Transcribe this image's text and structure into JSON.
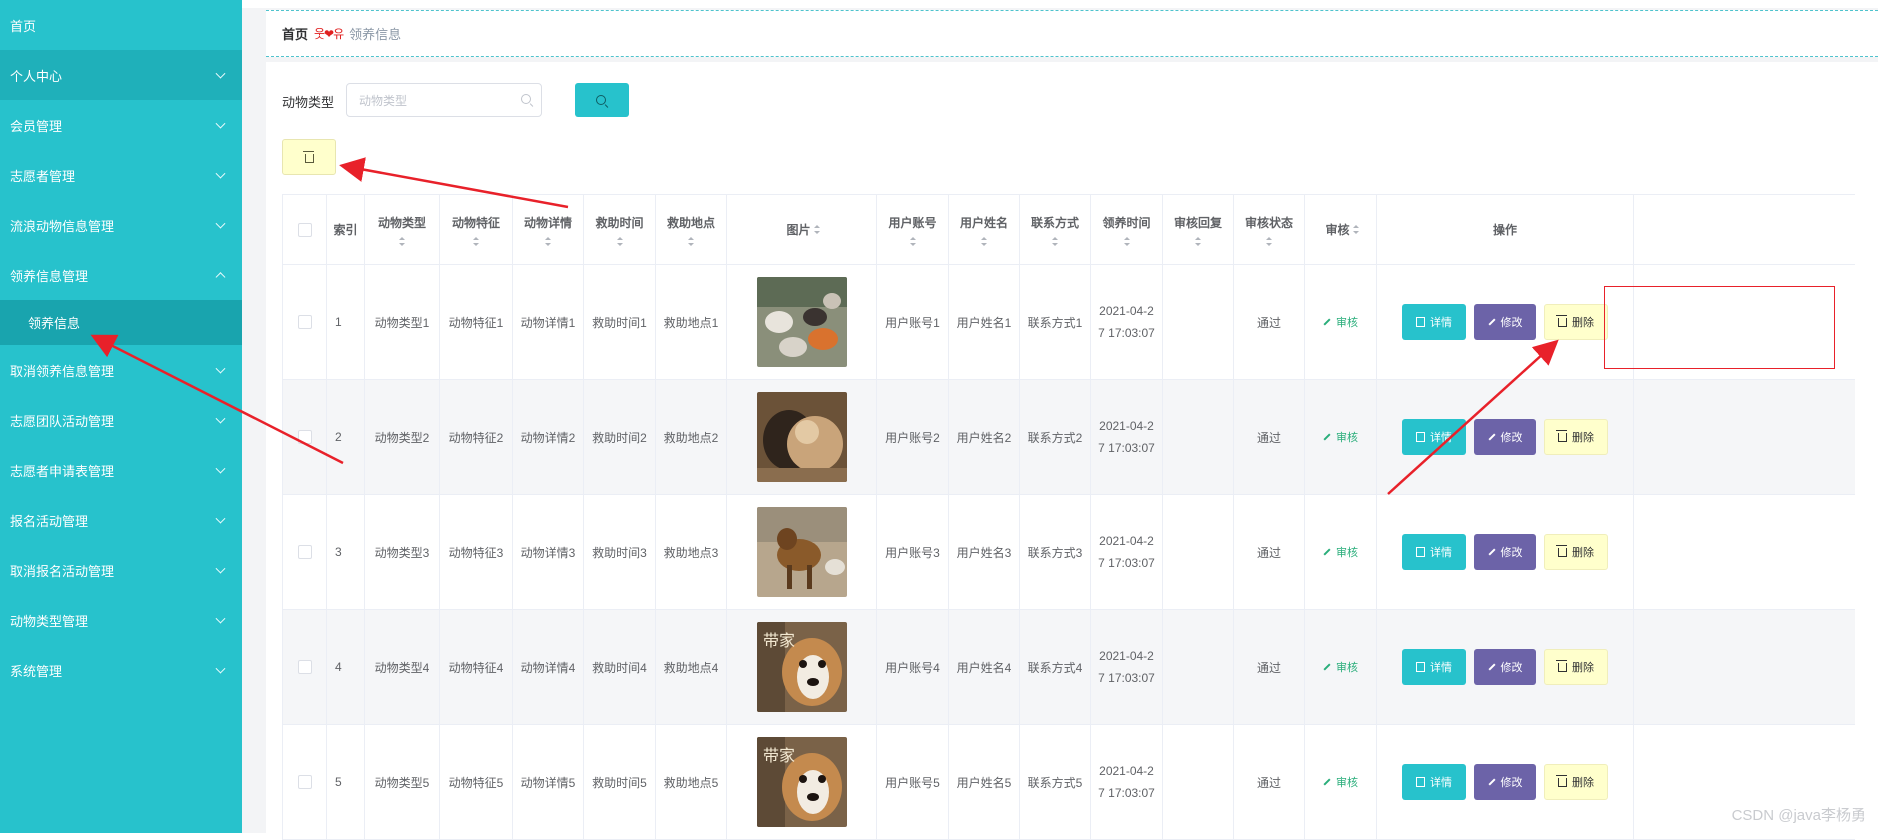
{
  "sidebar": {
    "items": [
      {
        "label": "首页",
        "has_arrow": false
      },
      {
        "label": "个人中心",
        "has_arrow": true
      },
      {
        "label": "会员管理",
        "has_arrow": true
      },
      {
        "label": "志愿者管理",
        "has_arrow": true
      },
      {
        "label": "流浪动物信息管理",
        "has_arrow": true
      },
      {
        "label": "领养信息管理",
        "has_arrow": true,
        "expanded": true
      },
      {
        "label": "领养信息",
        "submenu": true
      },
      {
        "label": "取消领养信息管理",
        "has_arrow": true
      },
      {
        "label": "志愿团队活动管理",
        "has_arrow": true
      },
      {
        "label": "志愿者申请表管理",
        "has_arrow": true
      },
      {
        "label": "报名活动管理",
        "has_arrow": true
      },
      {
        "label": "取消报名活动管理",
        "has_arrow": true
      },
      {
        "label": "动物类型管理",
        "has_arrow": true
      },
      {
        "label": "系统管理",
        "has_arrow": true
      }
    ]
  },
  "breadcrumb": {
    "home": "首页",
    "separator": "웃❤유",
    "current": "领养信息"
  },
  "search": {
    "label": "动物类型",
    "placeholder": "动物类型"
  },
  "table": {
    "headers": [
      "索引",
      "动物类型",
      "动物特征",
      "动物详情",
      "救助时间",
      "救助地点",
      "图片",
      "用户账号",
      "用户姓名",
      "联系方式",
      "领养时间",
      "审核回复",
      "审核状态",
      "审核",
      "操作"
    ],
    "rows": [
      {
        "index": "1",
        "type": "动物类型1",
        "feature": "动物特征1",
        "detail": "动物详情1",
        "rescue_time": "救助时间1",
        "rescue_place": "救助地点1",
        "image": "cats photo",
        "account": "用户账号1",
        "name": "用户姓名1",
        "contact": "联系方式1",
        "date_line1": "2021-04-2",
        "date_line2": "7 17:03:07",
        "reply": "",
        "status": "通过",
        "audit": "审核"
      },
      {
        "index": "2",
        "type": "动物类型2",
        "feature": "动物特征2",
        "detail": "动物详情2",
        "rescue_time": "救助时间2",
        "rescue_place": "救助地点2",
        "image": "dogs cuddling photo",
        "account": "用户账号2",
        "name": "用户姓名2",
        "contact": "联系方式2",
        "date_line1": "2021-04-2",
        "date_line2": "7 17:03:07",
        "reply": "",
        "status": "通过",
        "audit": "审核"
      },
      {
        "index": "3",
        "type": "动物类型3",
        "feature": "动物特征3",
        "detail": "动物详情3",
        "rescue_time": "救助时间3",
        "rescue_place": "救助地点3",
        "image": "stray dog photo",
        "account": "用户账号3",
        "name": "用户姓名3",
        "contact": "联系方式3",
        "date_line1": "2021-04-2",
        "date_line2": "7 17:03:07",
        "reply": "",
        "status": "通过",
        "audit": "审核"
      },
      {
        "index": "4",
        "type": "动物类型4",
        "feature": "动物特征4",
        "detail": "动物详情4",
        "rescue_time": "救助时间4",
        "rescue_place": "救助地点4",
        "image": "puppy poster",
        "image_text": "带家",
        "account": "用户账号4",
        "name": "用户姓名4",
        "contact": "联系方式4",
        "date_line1": "2021-04-2",
        "date_line2": "7 17:03:07",
        "reply": "",
        "status": "通过",
        "audit": "审核"
      },
      {
        "index": "5",
        "type": "动物类型5",
        "feature": "动物特征5",
        "detail": "动物详情5",
        "rescue_time": "救助时间5",
        "rescue_place": "救助地点5",
        "image": "puppy poster",
        "image_text": "带家",
        "account": "用户账号5",
        "name": "用户姓名5",
        "contact": "联系方式5",
        "date_line1": "2021-04-2",
        "date_line2": "7 17:03:07",
        "reply": "",
        "status": "通过",
        "audit": "审核"
      }
    ],
    "actions": {
      "detail": "详情",
      "edit": "修改",
      "delete": "删除"
    }
  },
  "watermark": "CSDN @java李杨勇",
  "colors": {
    "sidebar": "#27c2cc",
    "primary": "#27c2cc",
    "edit": "#6c63a8",
    "delete": "#ffffcc",
    "annotation": "#e8212a",
    "audit_link": "#2aae7b"
  }
}
